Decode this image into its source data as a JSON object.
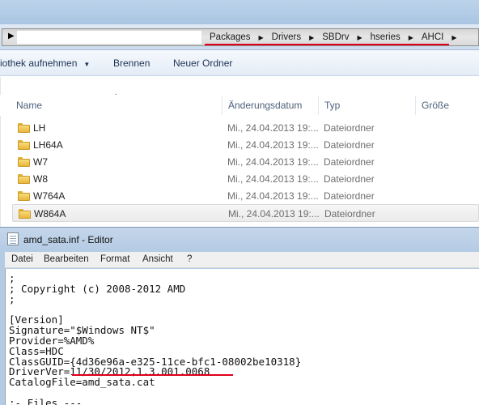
{
  "explorer": {
    "address": {
      "crumbs": [
        "Packages",
        "Drivers",
        "SBDrv",
        "hseries",
        "AHCI"
      ]
    },
    "toolbar": {
      "include_library": "iothek aufnehmen",
      "burn": "Brennen",
      "new_folder": "Neuer Ordner"
    },
    "columns": {
      "name": "Name",
      "date": "Änderungsdatum",
      "type": "Typ",
      "size": "Größe"
    },
    "rows": [
      {
        "name": "LH",
        "date": "Mi., 24.04.2013 19:...",
        "type": "Dateiordner"
      },
      {
        "name": "LH64A",
        "date": "Mi., 24.04.2013 19:...",
        "type": "Dateiordner"
      },
      {
        "name": "W7",
        "date": "Mi., 24.04.2013 19:...",
        "type": "Dateiordner"
      },
      {
        "name": "W8",
        "date": "Mi., 24.04.2013 19:...",
        "type": "Dateiordner"
      },
      {
        "name": "W764A",
        "date": "Mi., 24.04.2013 19:...",
        "type": "Dateiordner"
      },
      {
        "name": "W864A",
        "date": "Mi., 24.04.2013 19:...",
        "type": "Dateiordner",
        "selected": true
      }
    ]
  },
  "editor": {
    "title": "amd_sata.inf - Editor",
    "menu": {
      "file": "Datei",
      "edit": "Bearbeiten",
      "format": "Format",
      "view": "Ansicht",
      "help": "?"
    },
    "lines": [
      ";",
      "; Copyright (c) 2008-2012 AMD",
      ";",
      "",
      "[Version]",
      "Signature=\"$Windows NT$\"",
      "Provider=%AMD%",
      "Class=HDC",
      "ClassGUID={4d36e96a-e325-11ce-bfc1-08002be10318}",
      "DriverVer=11/30/2012,1.3.001.0068",
      "CatalogFile=amd_sata.cat",
      "",
      ";- Files ---"
    ]
  },
  "colors": {
    "highlight": "#e0001b",
    "titlebar": "#b4cbe4"
  }
}
